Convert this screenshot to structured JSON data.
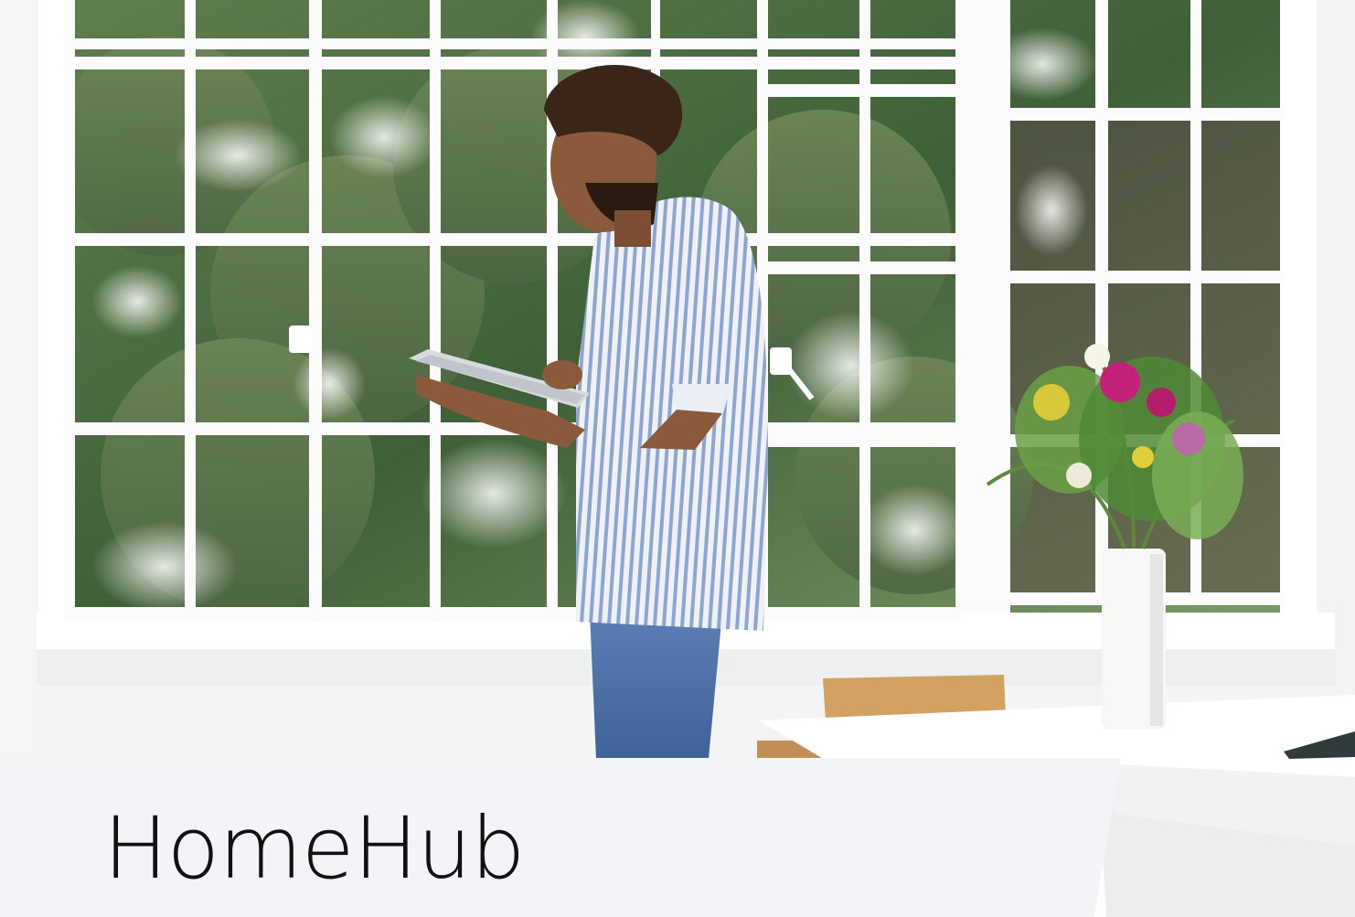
{
  "app": {
    "title": "HomeHub"
  },
  "hero": {
    "image_description_icon": "hero-photo-icon"
  }
}
